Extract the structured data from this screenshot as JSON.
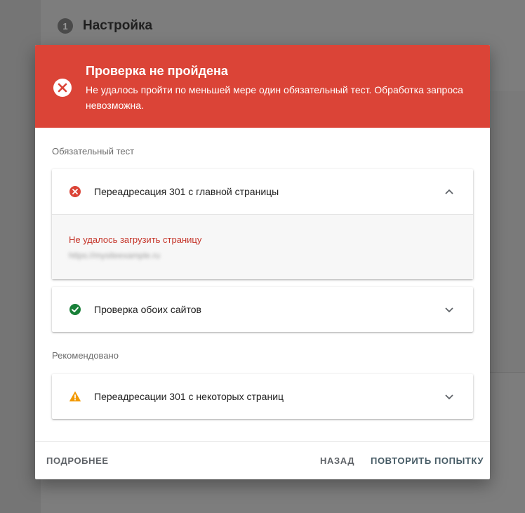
{
  "background": {
    "step_number": "1",
    "step_title": "Настройка"
  },
  "dialog": {
    "header": {
      "title": "Проверка не пройдена",
      "message": "Не удалось пройти по меньшей мере один обязательный тест. Обработка запроса невозможна.",
      "icon": "error-icon",
      "color": "#db4437"
    },
    "required_section": {
      "label": "Обязательный тест",
      "tests": [
        {
          "title": "Переадресация 301 с главной страницы",
          "status": "error",
          "status_icon": "error-circle-icon",
          "expanded": true,
          "error_text": "Не удалось загрузить страницу",
          "url": "https://mysiteexample.ru"
        },
        {
          "title": "Проверка обоих сайтов",
          "status": "passed",
          "status_icon": "check-circle-icon",
          "expanded": false
        }
      ]
    },
    "recommended_section": {
      "label": "Рекомендовано",
      "tests": [
        {
          "title": "Переадресации 301 с некоторых страниц",
          "status": "warning",
          "status_icon": "warning-icon",
          "expanded": false
        }
      ]
    },
    "footer": {
      "details_label": "ПОДРОБНЕЕ",
      "back_label": "НАЗАД",
      "retry_label": "ПОВТОРИТЬ ПОПЫТКУ"
    }
  },
  "colors": {
    "error": "#db4437",
    "success": "#188038",
    "warning": "#f29900",
    "link": "#455a64"
  }
}
